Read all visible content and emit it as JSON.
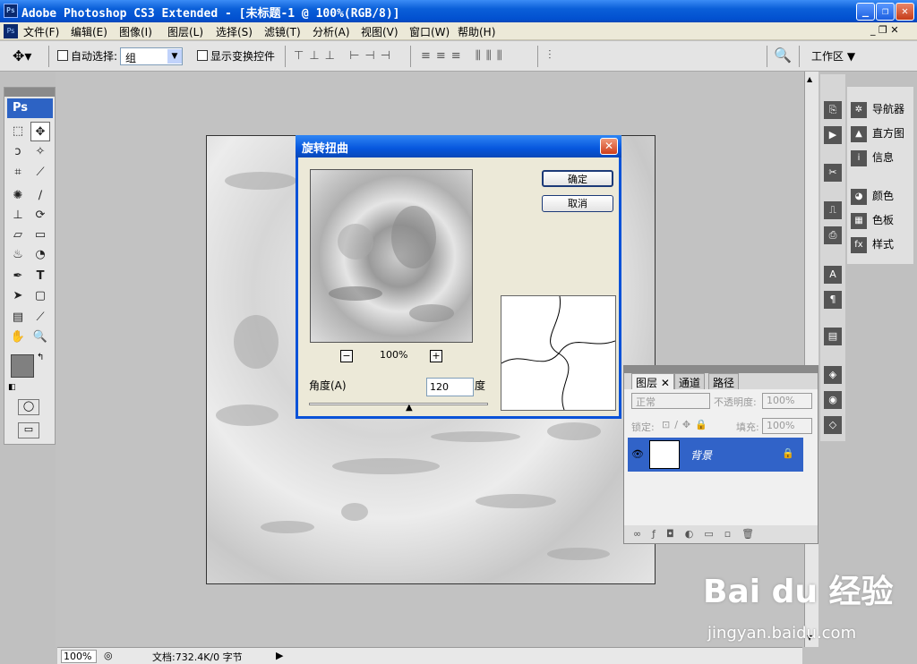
{
  "window": {
    "title": "Adobe Photoshop CS3 Extended - [未标题-1 @ 100%(RGB/8)]",
    "app_icon": "Ps"
  },
  "menu": [
    "文件(F)",
    "编辑(E)",
    "图像(I)",
    "图层(L)",
    "选择(S)",
    "滤镜(T)",
    "分析(A)",
    "视图(V)",
    "窗口(W)",
    "帮助(H)"
  ],
  "options": {
    "auto_select_label": "自动选择:",
    "auto_select_value": "组",
    "show_transform_label": "显示变换控件",
    "workspace_label": "工作区 ▼"
  },
  "toolbox": {
    "logo": "Ps"
  },
  "dialog": {
    "title": "旋转扭曲",
    "ok_label": "确定",
    "cancel_label": "取消",
    "zoom": "100%",
    "angle_label": "角度(A)",
    "angle_value": "120",
    "angle_unit": "度",
    "angle_slider": 0.56
  },
  "layers_panel": {
    "tabs": [
      "图层",
      "通道",
      "路径"
    ],
    "blend_mode": "正常",
    "opacity_label": "不透明度:",
    "opacity_value": "100%",
    "lock_label": "锁定:",
    "fill_label": "填充:",
    "fill_value": "100%",
    "layer_name": "背景"
  },
  "right_panel": {
    "items": [
      "导航器",
      "直方图",
      "信息",
      "颜色",
      "色板",
      "样式"
    ]
  },
  "status": {
    "zoom": "100%",
    "doc_info": "文档:732.4K/0 字节"
  },
  "watermark": {
    "brand": "Bai du 经验",
    "url": "jingyan.baidu.com"
  }
}
